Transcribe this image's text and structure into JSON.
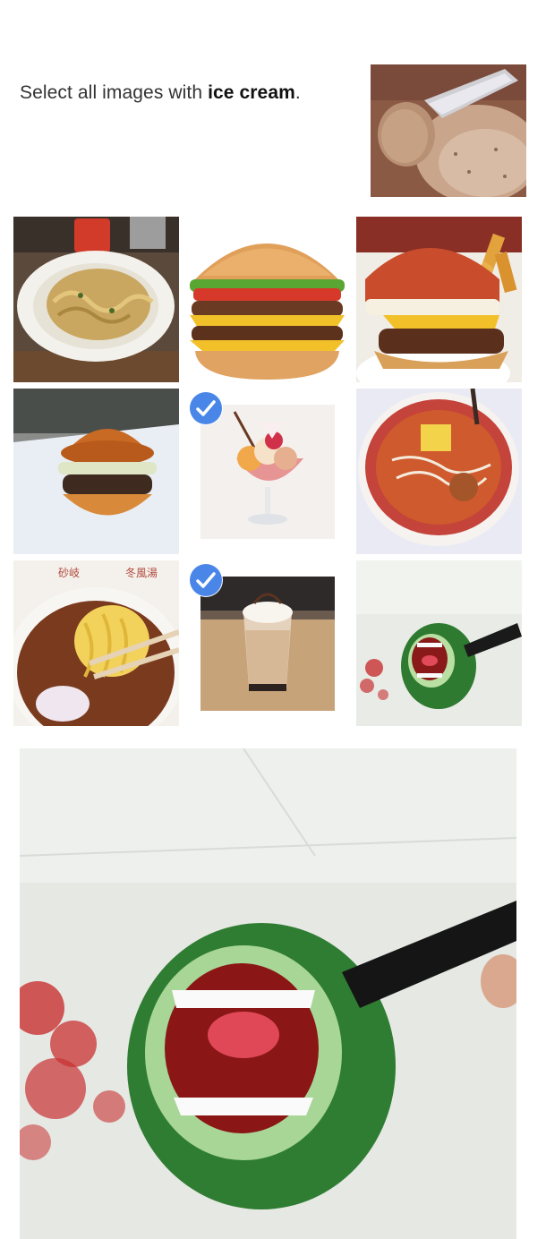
{
  "prompt": {
    "prefix": "Select all images with ",
    "target": "ice cream",
    "suffix": "."
  },
  "example_image": {
    "subject": "ice cream scoop"
  },
  "grid": {
    "rows": 3,
    "cols": 3,
    "tiles": [
      {
        "subject": "spaghetti",
        "selected": false
      },
      {
        "subject": "double cheeseburger",
        "selected": false
      },
      {
        "subject": "burger with fries",
        "selected": false
      },
      {
        "subject": "burger",
        "selected": false
      },
      {
        "subject": "ice cream sundae",
        "selected": true
      },
      {
        "subject": "ramen bowl",
        "selected": false
      },
      {
        "subject": "ramen noodles",
        "selected": false
      },
      {
        "subject": "milkshake",
        "selected": true
      },
      {
        "subject": "watermelon monster",
        "selected": false
      }
    ]
  },
  "enlarged_image": {
    "subject": "watermelon monster"
  },
  "colors": {
    "check_blue": "#4a86e8",
    "selection_bg": "#ffffff"
  },
  "icons": {
    "selected": "checkmark-icon"
  }
}
